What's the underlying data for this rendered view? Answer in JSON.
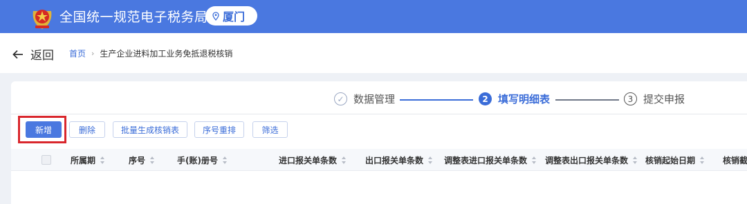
{
  "header": {
    "title": "全国统一规范电子税务局",
    "city": "厦门",
    "brand_color": "#4a78e0"
  },
  "nav": {
    "back_label": "返回",
    "breadcrumb": {
      "home": "首页",
      "current": "生产企业进料加工业务免抵退税核销"
    }
  },
  "steps": [
    {
      "index": "✓",
      "label": "数据管理",
      "state": "done"
    },
    {
      "index": "2",
      "label": "填写明细表",
      "state": "active"
    },
    {
      "index": "3",
      "label": "提交申报",
      "state": "pending"
    }
  ],
  "toolbar": {
    "add": "新增",
    "delete": "删除",
    "batch_generate": "批量生成核销表",
    "reorder": "序号重排",
    "filter": "筛选"
  },
  "table": {
    "columns": [
      "所属期",
      "序号",
      "手(账)册号",
      "进口报关单条数",
      "出口报关单条数",
      "调整表进口报关单条数",
      "调整表出口报关单条数",
      "核销起始日期",
      "核销截"
    ]
  },
  "colors": {
    "highlight_border": "#d9262c",
    "accent": "#3a6cd8"
  }
}
